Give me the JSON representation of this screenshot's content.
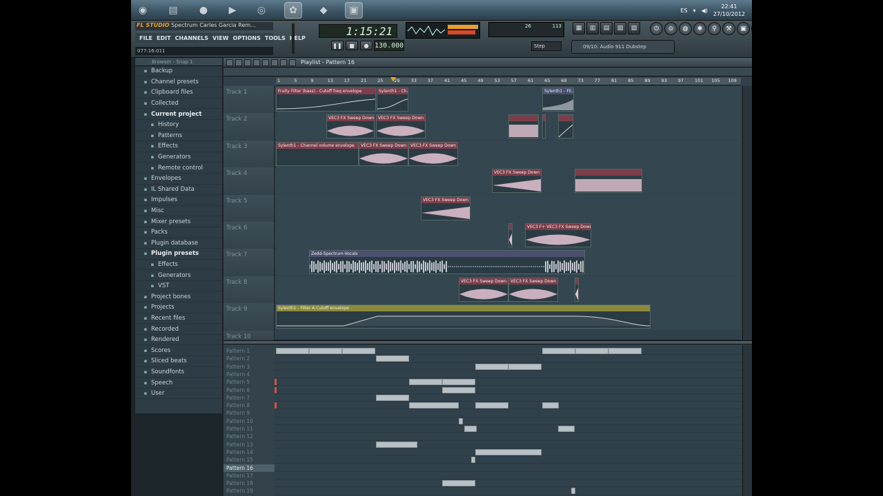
{
  "taskbar": {
    "lang": "ES",
    "time": "22:41",
    "date": "27/10/2012",
    "apps": [
      {
        "name": "windows-start-icon",
        "glyph": "◉"
      },
      {
        "name": "folder-icon",
        "glyph": "▤"
      },
      {
        "name": "firefox-icon",
        "glyph": "●"
      },
      {
        "name": "media-player-icon",
        "glyph": "▶"
      },
      {
        "name": "chrome-icon",
        "glyph": "◎"
      },
      {
        "name": "fl-studio-icon",
        "glyph": "✿"
      },
      {
        "name": "app-red-icon",
        "glyph": "◆"
      },
      {
        "name": "app-blue-icon",
        "glyph": "▣"
      }
    ]
  },
  "fl": {
    "logo": "FL STUDIO",
    "project_title": "Spectrum Carles Garcia Rem...",
    "menu": [
      "FILE",
      "EDIT",
      "CHANNELS",
      "VIEW",
      "OPTIONS",
      "TOOLS",
      "HELP"
    ],
    "hint": "077:16:011",
    "time": "1:15:21",
    "tempo": "130.000",
    "snap": "Step",
    "cpu_a": "26",
    "cpu_b": "113",
    "hint_bar": "09/10: Audio 911 Dubstep"
  },
  "browser": {
    "title": "Browser - Snap 1",
    "items": [
      {
        "label": "Backup",
        "level": 1,
        "open": false
      },
      {
        "label": "Channel presets",
        "level": 1,
        "open": false
      },
      {
        "label": "Clipboard files",
        "level": 1,
        "open": false
      },
      {
        "label": "Collected",
        "level": 1,
        "open": false
      },
      {
        "label": "Current project",
        "level": 1,
        "open": true
      },
      {
        "label": "History",
        "level": 2,
        "open": false
      },
      {
        "label": "Patterns",
        "level": 2,
        "open": false
      },
      {
        "label": "Effects",
        "level": 2,
        "open": false
      },
      {
        "label": "Generators",
        "level": 2,
        "open": false
      },
      {
        "label": "Remote control",
        "level": 2,
        "open": false
      },
      {
        "label": "Envelopes",
        "level": 1,
        "open": false
      },
      {
        "label": "IL Shared Data",
        "level": 1,
        "open": false
      },
      {
        "label": "Impulses",
        "level": 1,
        "open": false
      },
      {
        "label": "Misc",
        "level": 1,
        "open": false
      },
      {
        "label": "Mixer presets",
        "level": 1,
        "open": false
      },
      {
        "label": "Packs",
        "level": 1,
        "open": false
      },
      {
        "label": "Plugin database",
        "level": 1,
        "open": false
      },
      {
        "label": "Plugin presets",
        "level": 1,
        "open": true
      },
      {
        "label": "Effects",
        "level": 2,
        "open": false
      },
      {
        "label": "Generators",
        "level": 2,
        "open": false
      },
      {
        "label": "VST",
        "level": 2,
        "open": false
      },
      {
        "label": "Project bones",
        "level": 1,
        "open": false
      },
      {
        "label": "Projects",
        "level": 1,
        "open": false
      },
      {
        "label": "Recent files",
        "level": 1,
        "open": false
      },
      {
        "label": "Recorded",
        "level": 1,
        "open": false
      },
      {
        "label": "Rendered",
        "level": 1,
        "open": false
      },
      {
        "label": "Scores",
        "level": 1,
        "open": false
      },
      {
        "label": "Sliced beats",
        "level": 1,
        "open": false
      },
      {
        "label": "Soundfonts",
        "level": 1,
        "open": false
      },
      {
        "label": "Speech",
        "level": 1,
        "open": false
      },
      {
        "label": "User",
        "level": 1,
        "open": false
      }
    ]
  },
  "playlist": {
    "title": "Playlist - Pattern 16",
    "ruler": [
      "1",
      "5",
      "9",
      "13",
      "17",
      "21",
      "25",
      "29",
      "33",
      "37",
      "41",
      "45",
      "49",
      "53",
      "57",
      "61",
      "65",
      "69",
      "73",
      "77",
      "81",
      "85",
      "89",
      "93",
      "97",
      "101",
      "105",
      "109"
    ],
    "tracks": [
      {
        "name": "Track 1",
        "clips": [
          {
            "label": "Fruity Filter (bass) - Cutoff freq envelope",
            "color": "red"
          },
          {
            "label": "Sylenth1 - Ch...",
            "color": "red"
          },
          {
            "label": "Sylenth1 - Fil...",
            "color": "blue"
          }
        ]
      },
      {
        "name": "Track 2",
        "clips": [
          {
            "label": "VEC3 FX Sweep Down ...",
            "color": "red"
          },
          {
            "label": "VEC3 FX Sweep Down ...",
            "color": "red"
          },
          {
            "label": "",
            "color": "red"
          },
          {
            "label": "",
            "color": "red"
          },
          {
            "label": "",
            "color": "red"
          }
        ]
      },
      {
        "name": "Track 3",
        "clips": [
          {
            "label": "Sylenth1 - Channel volume envelope",
            "color": "red"
          },
          {
            "label": "VEC3 FX Sweep Down ...",
            "color": "red"
          },
          {
            "label": "VEC3 FX Sweep Down ...",
            "color": "red"
          }
        ]
      },
      {
        "name": "Track 4",
        "clips": [
          {
            "label": "VEC3 FX Sweep Down ...",
            "color": "red"
          },
          {
            "label": "",
            "color": "red"
          }
        ]
      },
      {
        "name": "Track 5",
        "clips": [
          {
            "label": "VEC3 FX Sweep Down ...",
            "color": "red"
          }
        ]
      },
      {
        "name": "Track 6",
        "clips": [
          {
            "label": "",
            "color": "red"
          },
          {
            "label": "VEC3 F+ VEC3 FX Sweep Down ...",
            "color": "red"
          }
        ]
      },
      {
        "name": "Track 7",
        "clips": [
          {
            "label": "Zedd-Spectrum-Vocals",
            "color": "blue"
          }
        ]
      },
      {
        "name": "Track 8",
        "clips": [
          {
            "label": "VEC3 FX Sweep Down ...",
            "color": "red"
          },
          {
            "label": "VEC3 FX Sweep Down ...",
            "color": "red"
          },
          {
            "label": "",
            "color": "red"
          }
        ]
      },
      {
        "name": "Track 9",
        "clips": [
          {
            "label": "Sylenth1 - Filter A Cutoff envelope",
            "color": "yel"
          }
        ]
      }
    ],
    "track10": "Track 10",
    "patterns": [
      "Pattern 1",
      "Pattern 2",
      "Pattern 3",
      "Pattern 4",
      "Pattern 5",
      "Pattern 6",
      "Pattern 7",
      "Pattern 8",
      "Pattern 9",
      "Pattern 10",
      "Pattern 11",
      "Pattern 12",
      "Pattern 13",
      "Pattern 14",
      "Pattern 15",
      "Pattern 16",
      "Pattern 17",
      "Pattern 18",
      "Pattern 19"
    ],
    "selected_pattern": "Pattern 16"
  }
}
